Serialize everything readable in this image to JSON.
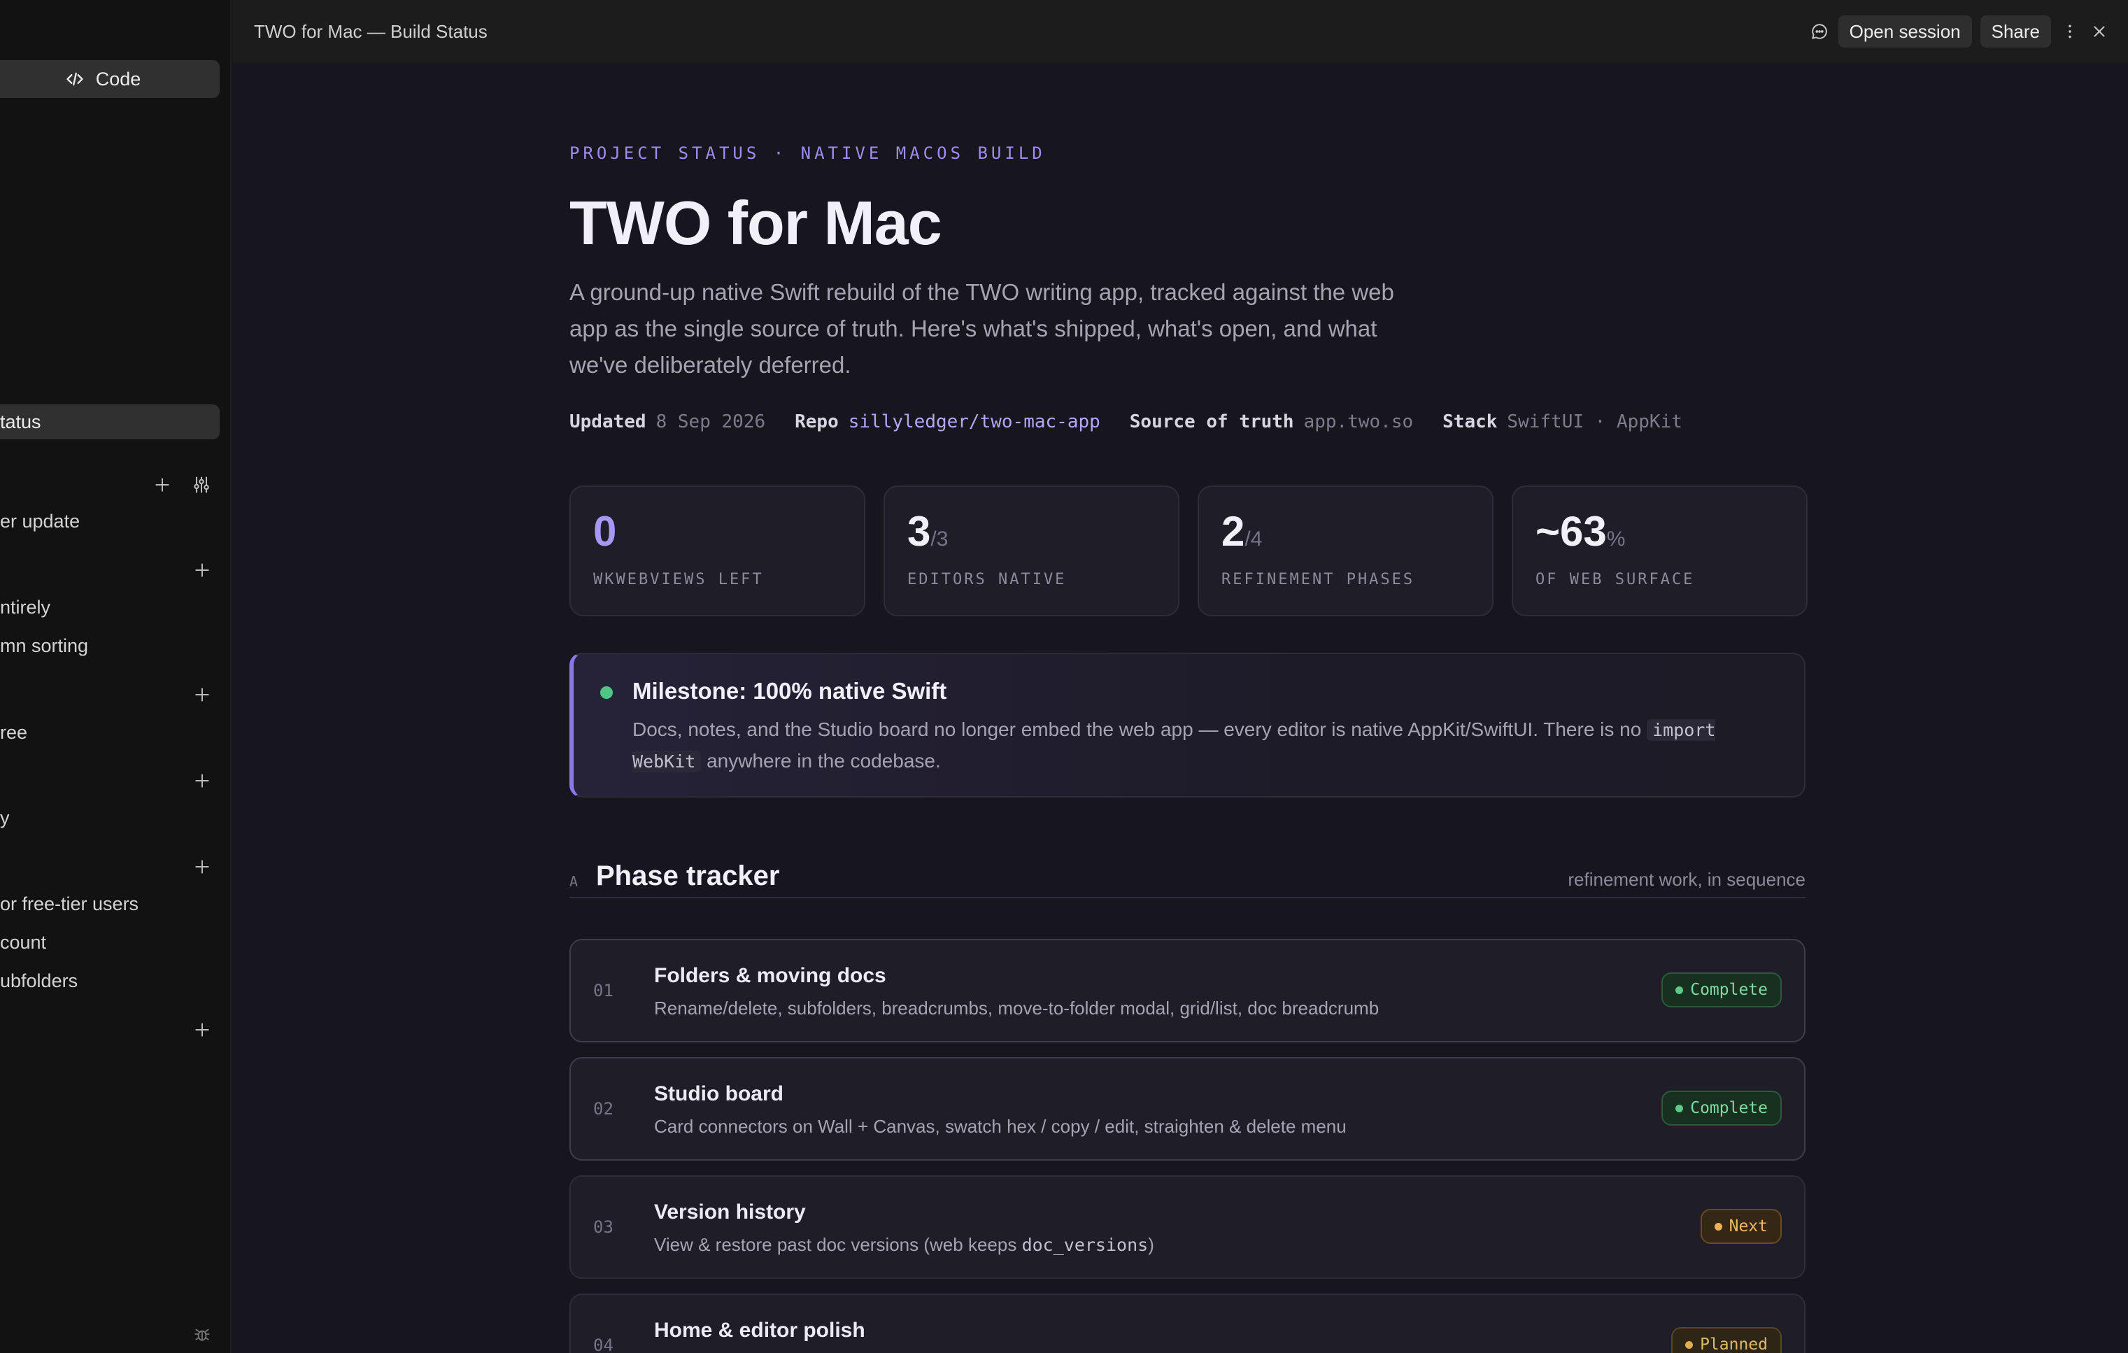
{
  "window": {
    "title": "TWO for Mac — Build Status"
  },
  "topbar": {
    "open_session_label": "Open session",
    "share_label": "Share"
  },
  "sidebar": {
    "code_label": "Code",
    "active_item": "tatus",
    "items": [
      "er update",
      "ntirely",
      "mn sorting",
      "ree",
      "y",
      "or free-tier users",
      "count",
      "ubfolders"
    ]
  },
  "header": {
    "eyebrow": "PROJECT STATUS · NATIVE MACOS BUILD",
    "title": "TWO for Mac",
    "subtitle": "A ground-up native Swift rebuild of the TWO writing app, tracked against the web app as the single source of truth. Here's what's shipped, what's open, and what we've deliberately deferred."
  },
  "meta": {
    "updated_label": "Updated",
    "updated_value": "8 Sep 2026",
    "repo_label": "Repo",
    "repo_value": "sillyledger/two-mac-app",
    "source_label": "Source of truth",
    "source_value": "app.two.so",
    "stack_label": "Stack",
    "stack_value": "SwiftUI · AppKit"
  },
  "stats": [
    {
      "value": "0",
      "suffix": "",
      "label": "WKWEBVIEWS LEFT",
      "accent": true
    },
    {
      "value": "3",
      "suffix": "/3",
      "label": "EDITORS NATIVE",
      "accent": false
    },
    {
      "value": "2",
      "suffix": "/4",
      "label": "REFINEMENT PHASES",
      "accent": false
    },
    {
      "value": "~63",
      "suffix": "%",
      "label": "OF WEB SURFACE",
      "accent": false
    }
  ],
  "milestone": {
    "title": "Milestone: 100% native Swift",
    "body_before": "Docs, notes, and the Studio board no longer embed the web app — every editor is native AppKit/SwiftUI. There is no",
    "code": "import WebKit",
    "body_after": "anywhere in the codebase."
  },
  "phase_tracker": {
    "letter": "A",
    "title": "Phase tracker",
    "note": "refinement work, in sequence",
    "phases": [
      {
        "num": "01",
        "title": "Folders & moving docs",
        "desc": "Rename/delete, subfolders, breadcrumbs, move-to-folder modal, grid/list, doc breadcrumb",
        "status": "Complete"
      },
      {
        "num": "02",
        "title": "Studio board",
        "desc": "Card connectors on Wall + Canvas, swatch hex / copy / edit, straighten & delete menu",
        "status": "Complete"
      },
      {
        "num": "03",
        "title": "Version history",
        "desc_before": "View & restore past doc versions (web keeps",
        "desc_code": "doc_versions",
        "desc_after": ")",
        "status": "Next"
      },
      {
        "num": "04",
        "title": "Home & editor polish",
        "desc": "",
        "status": "Planned"
      }
    ]
  }
}
